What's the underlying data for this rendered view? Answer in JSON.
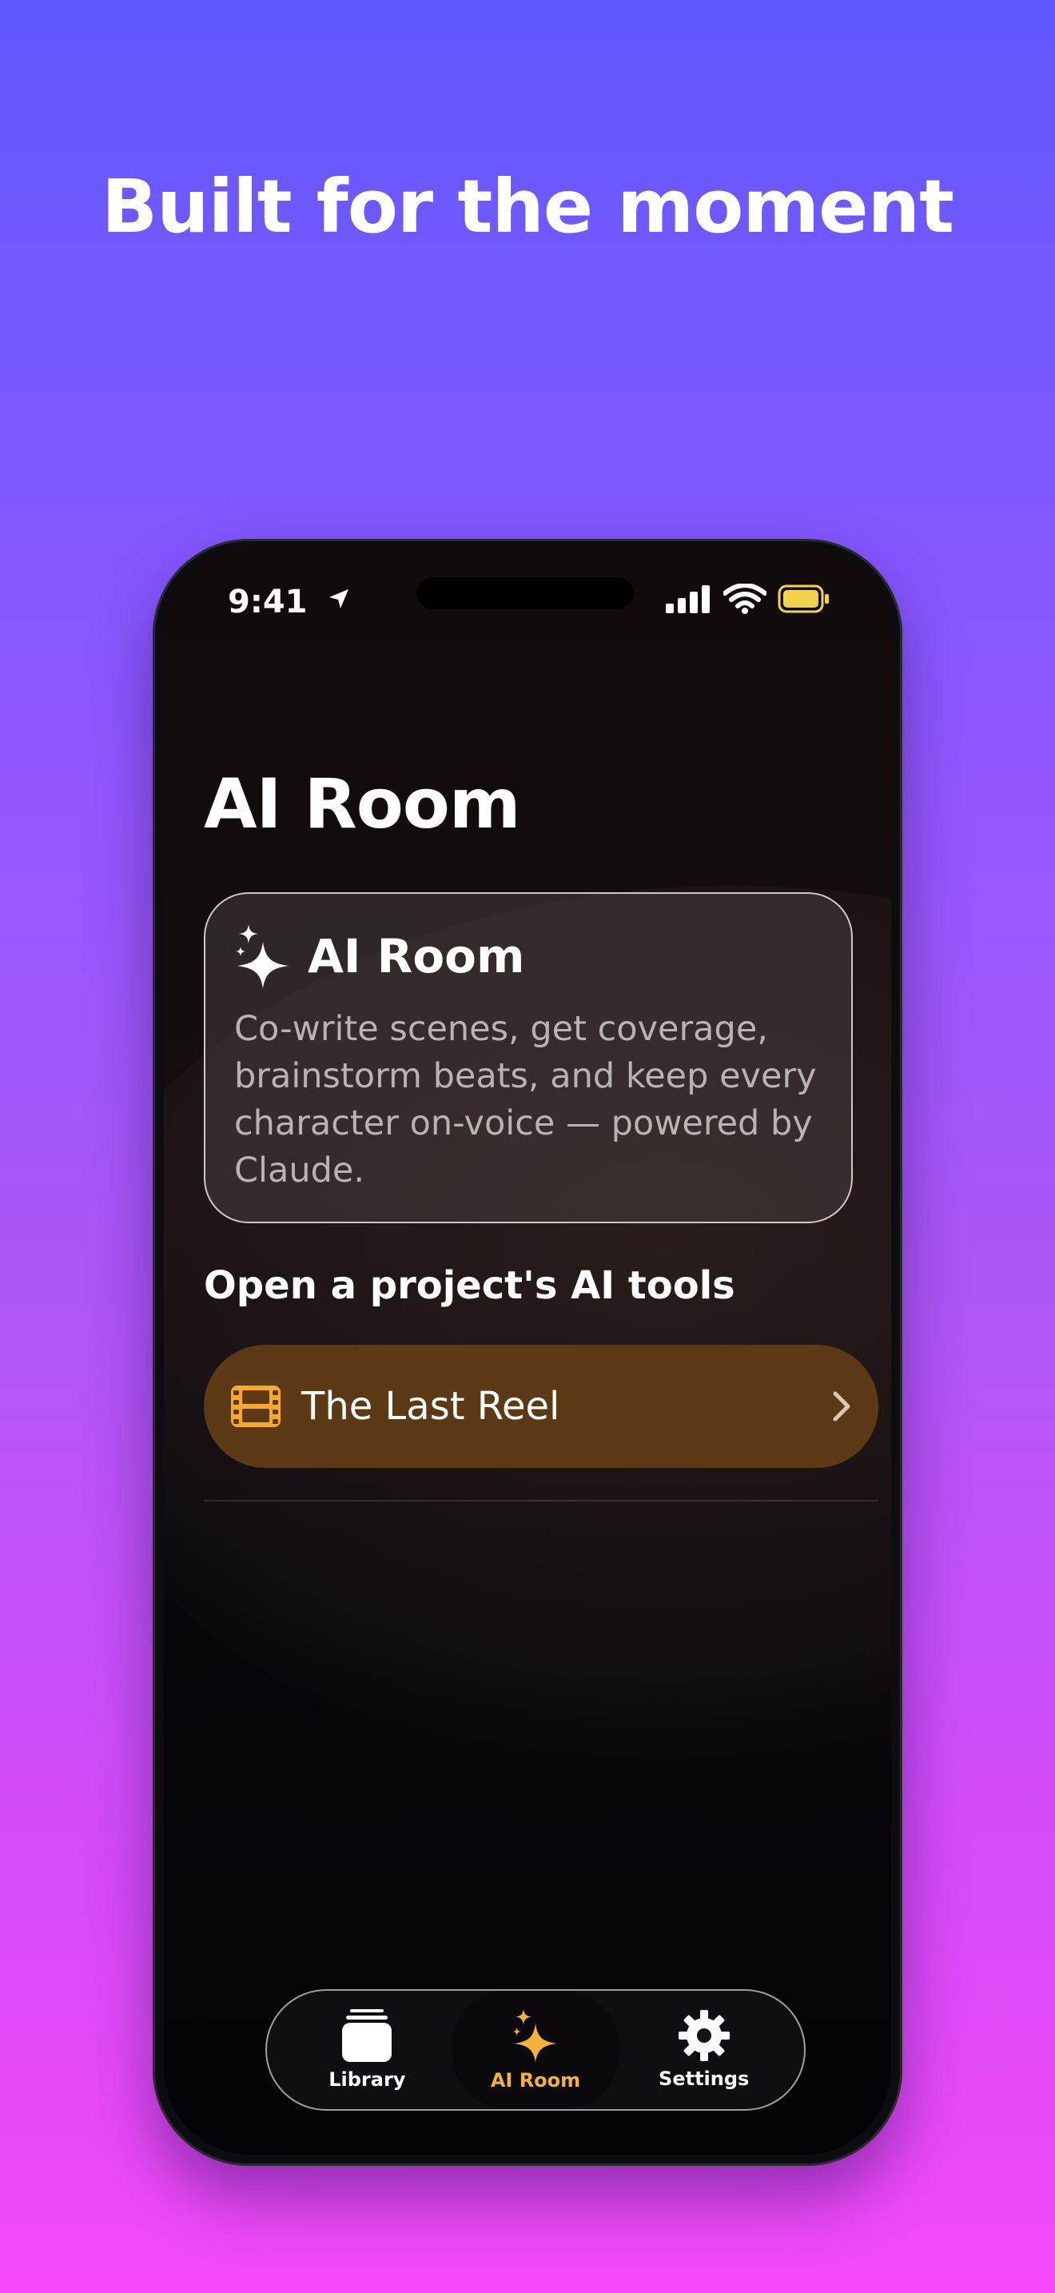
{
  "headline": "Built for the moment",
  "status": {
    "time": "9:41"
  },
  "page": {
    "title": "AI Room"
  },
  "hero_card": {
    "title": "AI Room",
    "body": "Co-write scenes, get coverage, brainstorm beats, and keep every character on-voice — powered by Claude."
  },
  "section": {
    "title": "Open a project's AI tools"
  },
  "projects": [
    {
      "label": "The Last Reel"
    }
  ],
  "tabs": [
    {
      "label": "Library",
      "icon": "stack-icon",
      "active": false
    },
    {
      "label": "AI Room",
      "icon": "sparkles-icon",
      "active": true
    },
    {
      "label": "Settings",
      "icon": "gear-icon",
      "active": false
    }
  ],
  "colors": {
    "accent": "#f5b236",
    "project_row": "#5c3a16",
    "background_top": "#6158ff",
    "background_bottom": "#f44af9"
  }
}
